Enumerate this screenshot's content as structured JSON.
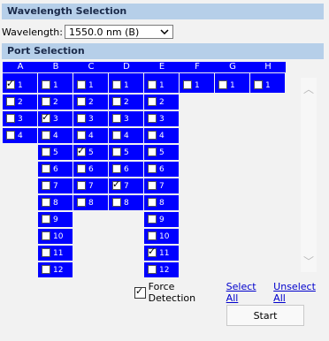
{
  "wavelength_section": {
    "title": "Wavelength Selection",
    "label": "Wavelength:",
    "selected": "1550.0 nm (B)"
  },
  "port_section": {
    "title": "Port Selection"
  },
  "columns": [
    {
      "name": "A",
      "ports": [
        {
          "n": "1",
          "checked": true
        },
        {
          "n": "2",
          "checked": false
        },
        {
          "n": "3",
          "checked": false
        },
        {
          "n": "4",
          "checked": false
        }
      ]
    },
    {
      "name": "B",
      "ports": [
        {
          "n": "1",
          "checked": false
        },
        {
          "n": "2",
          "checked": false
        },
        {
          "n": "3",
          "checked": true
        },
        {
          "n": "4",
          "checked": false
        },
        {
          "n": "5",
          "checked": false
        },
        {
          "n": "6",
          "checked": false
        },
        {
          "n": "7",
          "checked": false
        },
        {
          "n": "8",
          "checked": false
        },
        {
          "n": "9",
          "checked": false
        },
        {
          "n": "10",
          "checked": false
        },
        {
          "n": "11",
          "checked": false
        },
        {
          "n": "12",
          "checked": false
        }
      ]
    },
    {
      "name": "C",
      "ports": [
        {
          "n": "1",
          "checked": false
        },
        {
          "n": "2",
          "checked": false
        },
        {
          "n": "3",
          "checked": false
        },
        {
          "n": "4",
          "checked": false
        },
        {
          "n": "5",
          "checked": true
        },
        {
          "n": "6",
          "checked": false
        },
        {
          "n": "7",
          "checked": false
        },
        {
          "n": "8",
          "checked": false
        }
      ]
    },
    {
      "name": "D",
      "ports": [
        {
          "n": "1",
          "checked": false
        },
        {
          "n": "2",
          "checked": false
        },
        {
          "n": "3",
          "checked": false
        },
        {
          "n": "4",
          "checked": false
        },
        {
          "n": "5",
          "checked": false
        },
        {
          "n": "6",
          "checked": false
        },
        {
          "n": "7",
          "checked": true
        },
        {
          "n": "8",
          "checked": false
        }
      ]
    },
    {
      "name": "E",
      "ports": [
        {
          "n": "1",
          "checked": false
        },
        {
          "n": "2",
          "checked": false
        },
        {
          "n": "3",
          "checked": false
        },
        {
          "n": "4",
          "checked": false
        },
        {
          "n": "5",
          "checked": false
        },
        {
          "n": "6",
          "checked": false
        },
        {
          "n": "7",
          "checked": false
        },
        {
          "n": "8",
          "checked": false
        },
        {
          "n": "9",
          "checked": false
        },
        {
          "n": "10",
          "checked": false
        },
        {
          "n": "11",
          "checked": true
        },
        {
          "n": "12",
          "checked": false
        }
      ]
    },
    {
      "name": "F",
      "ports": [
        {
          "n": "1",
          "checked": false
        }
      ]
    },
    {
      "name": "G",
      "ports": [
        {
          "n": "1",
          "checked": false
        }
      ]
    },
    {
      "name": "H",
      "ports": [
        {
          "n": "1",
          "checked": false
        }
      ]
    }
  ],
  "footer": {
    "force_label": "Force Detection",
    "force_checked": true,
    "select_all": "Select All",
    "unselect_all": "Unselect All",
    "start": "Start"
  },
  "icons": {
    "dropdown": "chevron-down-icon",
    "scroll_up": "scroll-up-arrow-icon",
    "scroll_down": "scroll-down-arrow-icon"
  },
  "colors": {
    "port_blue": "#0000ff",
    "section_header": "#b6cfe9",
    "link": "#0000cc"
  }
}
